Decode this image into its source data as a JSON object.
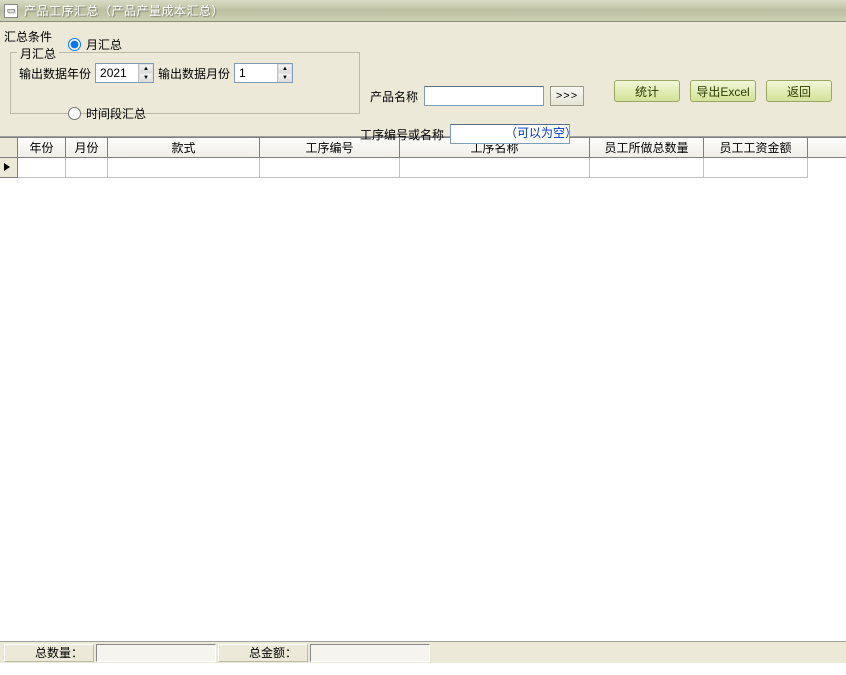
{
  "window": {
    "title": "产品工序汇总（产品产量成本汇总）"
  },
  "conditions": {
    "group_label": "汇总条件",
    "radio_month": "月汇总",
    "radio_range": "时间段汇总",
    "fieldset_legend": "月汇总",
    "year_label": "输出数据年份",
    "year_value": "2021",
    "month_label": "输出数据月份",
    "month_value": "1",
    "product_label": "产品名称",
    "product_value": "",
    "pick_btn": ">>>",
    "proc_label": "工序编号或名称",
    "proc_value": "",
    "hint": "（可以为空）"
  },
  "buttons": {
    "stat": "统计",
    "export": "导出Excel",
    "back": "返回"
  },
  "columns": {
    "c1": "年份",
    "c2": "月份",
    "c3": "款式",
    "c4": "工序编号",
    "c5": "工序名称",
    "c6": "员工所做总数量",
    "c7": "员工工资金额"
  },
  "status": {
    "total_qty_label": "总数量：",
    "total_qty_value": "",
    "total_amt_label": "总金额：",
    "total_amt_value": ""
  }
}
